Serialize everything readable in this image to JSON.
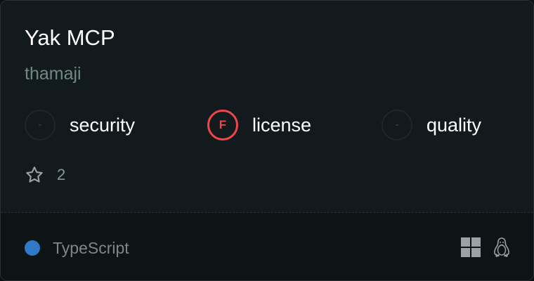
{
  "card": {
    "title": "Yak MCP",
    "author": "thamaji",
    "scores": [
      {
        "grade": "-",
        "label": "security"
      },
      {
        "grade": "F",
        "label": "license"
      },
      {
        "grade": "-",
        "label": "quality"
      }
    ],
    "stars": {
      "icon": "star-icon",
      "count": "2"
    },
    "language": {
      "name": "TypeScript",
      "color": "#3178c6"
    },
    "platforms": [
      "windows-icon",
      "linux-icon"
    ]
  },
  "colors": {
    "background": "#121a1d",
    "footer": "#0e1416",
    "grade_f": "#f1444b",
    "author": "#6f8a82"
  }
}
